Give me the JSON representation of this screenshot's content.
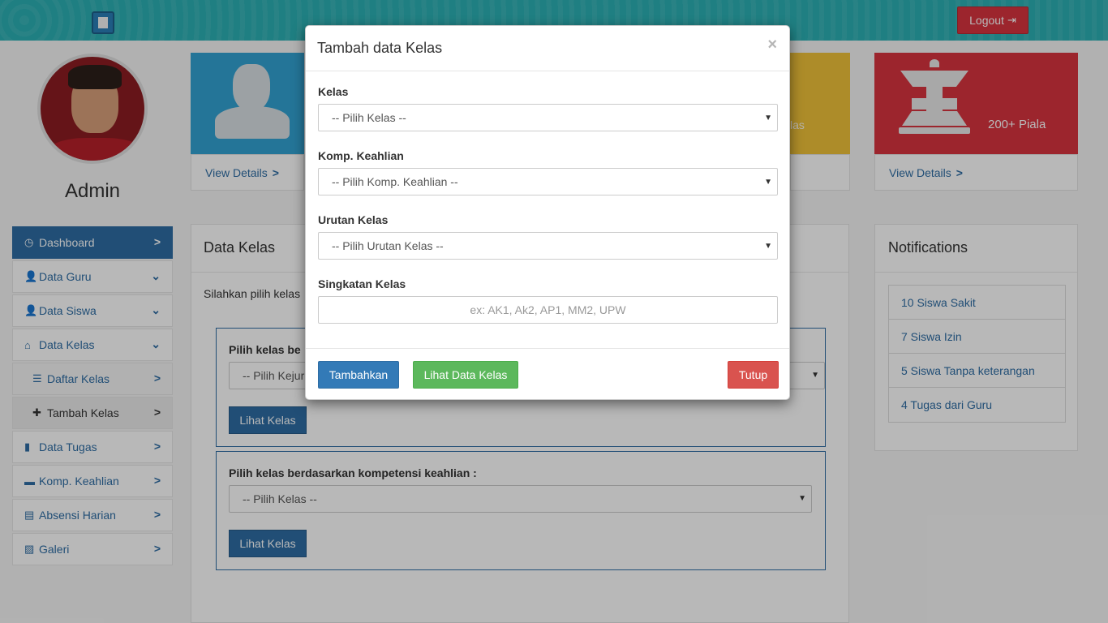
{
  "header": {
    "logout_label": "Logout"
  },
  "profile": {
    "name": "Admin"
  },
  "sidebar": {
    "items": [
      {
        "label": "Dashboard"
      },
      {
        "label": "Data Guru"
      },
      {
        "label": "Data Siswa"
      },
      {
        "label": "Data Kelas"
      },
      {
        "label": "Daftar Kelas"
      },
      {
        "label": "Tambah Kelas"
      },
      {
        "label": "Data Tugas"
      },
      {
        "label": "Komp. Keahlian"
      },
      {
        "label": "Absensi Harian"
      },
      {
        "label": "Galeri"
      }
    ]
  },
  "panels": {
    "view_details": "View Details",
    "yellow_partial": "las",
    "red_text": "200+ Piala"
  },
  "main": {
    "title": "Data Kelas",
    "intro": "Silahkan pilih kelas",
    "box1": {
      "label": "Pilih kelas be",
      "select": "-- Pilih Kejur",
      "button": "Lihat Kelas"
    },
    "box2": {
      "label": "Pilih kelas berdasarkan kompetensi keahlian :",
      "select": "-- Pilih Kelas --",
      "button": "Lihat Kelas"
    }
  },
  "notifications": {
    "title": "Notifications",
    "items": [
      "10 Siswa Sakit",
      "7 Siswa Izin",
      "5 Siswa Tanpa keterangan",
      "4 Tugas dari Guru"
    ]
  },
  "modal": {
    "title": "Tambah data Kelas",
    "close": "×",
    "fields": {
      "kelas": {
        "label": "Kelas",
        "value": "-- Pilih Kelas --"
      },
      "komp": {
        "label": "Komp. Keahlian",
        "value": "-- Pilih Komp. Keahlian --"
      },
      "urutan": {
        "label": "Urutan Kelas",
        "value": "-- Pilih Urutan Kelas --"
      },
      "singkatan": {
        "label": "Singkatan Kelas",
        "placeholder": "ex: AK1, Ak2, AP1, MM2, UPW"
      }
    },
    "buttons": {
      "add": "Tambahkan",
      "view": "Lihat Data Kelas",
      "close": "Tutup"
    }
  },
  "colors": {
    "topbar": "#2bb0b4",
    "primary": "#337ab7",
    "success": "#5cb85c",
    "danger": "#d9534f"
  }
}
